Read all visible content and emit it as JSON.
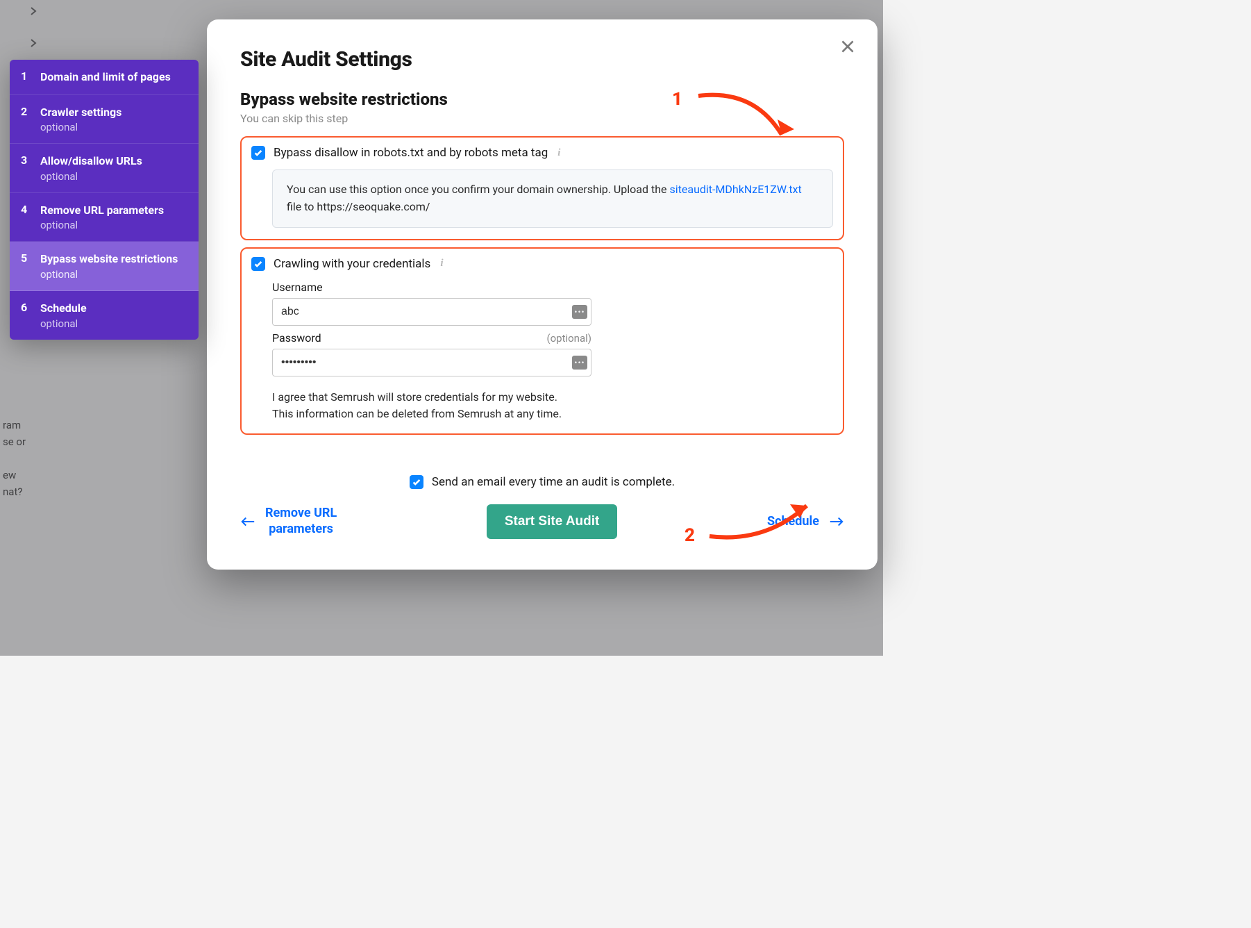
{
  "bg_lines": [
    "ram",
    "se or",
    "",
    "ew",
    "nat?"
  ],
  "sidebar": {
    "items": [
      {
        "num": "1",
        "title": "Domain and limit of pages",
        "sub": ""
      },
      {
        "num": "2",
        "title": "Crawler settings",
        "sub": "optional"
      },
      {
        "num": "3",
        "title": "Allow/disallow URLs",
        "sub": "optional"
      },
      {
        "num": "4",
        "title": "Remove URL parameters",
        "sub": "optional"
      },
      {
        "num": "5",
        "title": "Bypass website restrictions",
        "sub": "optional"
      },
      {
        "num": "6",
        "title": "Schedule",
        "sub": "optional"
      }
    ]
  },
  "modal": {
    "title": "Site Audit Settings",
    "heading": "Bypass website restrictions",
    "subheading": "You can skip this step",
    "bypass": {
      "label": "Bypass disallow in robots.txt and by robots meta tag",
      "hint_prefix": "You can use this option once you confirm your domain ownership. Upload the ",
      "hint_link": "siteaudit-MDhkNzE1ZW.txt",
      "hint_suffix": " file to https://seoquake.com/"
    },
    "creds": {
      "label": "Crawling with your credentials",
      "username_label": "Username",
      "username_value": "abc",
      "password_label": "Password",
      "password_optional": "(optional)",
      "password_value": "•••••••••",
      "agree": "I agree that Semrush will store credentials for my website. This information can be deleted from Semrush at any time."
    },
    "email_label": "Send an email every time an audit is complete.",
    "prev": "Remove URL parameters",
    "start": "Start Site Audit",
    "next": "Schedule"
  },
  "annotations": {
    "one": "1",
    "two": "2"
  }
}
